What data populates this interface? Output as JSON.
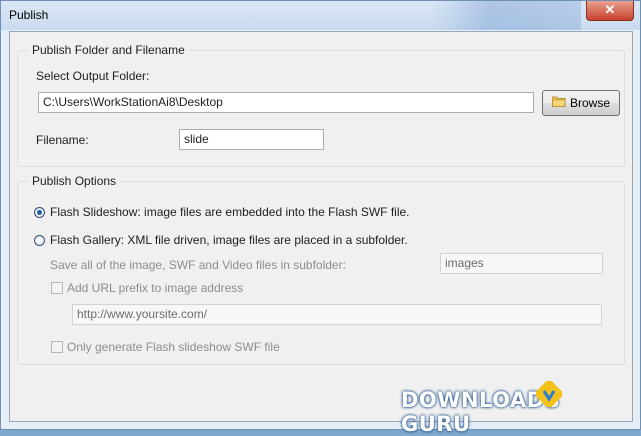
{
  "window": {
    "title": "Publish",
    "close_glyph": "✕"
  },
  "folder_group": {
    "legend": "Publish Folder and Filename",
    "select_label": "Select Output Folder:",
    "folder_value": "C:\\Users\\WorkStationAi8\\Desktop",
    "browse_label": "Browse",
    "filename_label": "Filename:",
    "filename_value": "slide"
  },
  "options_group": {
    "legend": "Publish Options",
    "radio_slideshow": "Flash Slideshow: image files are embedded into the Flash SWF file.",
    "radio_gallery": "Flash Gallery: XML file driven, image files are placed in a subfolder.",
    "subfolder_label": "Save all of the image, SWF and Video files in subfolder:",
    "subfolder_value": "images",
    "url_prefix_label": "Add URL prefix to image address",
    "url_value": "http://www.yoursite.com/",
    "only_swf_label": "Only generate Flash slideshow SWF file"
  },
  "watermark": {
    "text": "DOWNLOADS",
    "suffix": "GURU"
  },
  "icons": {
    "browse": "folder-icon",
    "close": "close-icon"
  },
  "colors": {
    "accent": "#1d5fa8",
    "close": "#c8432e"
  }
}
